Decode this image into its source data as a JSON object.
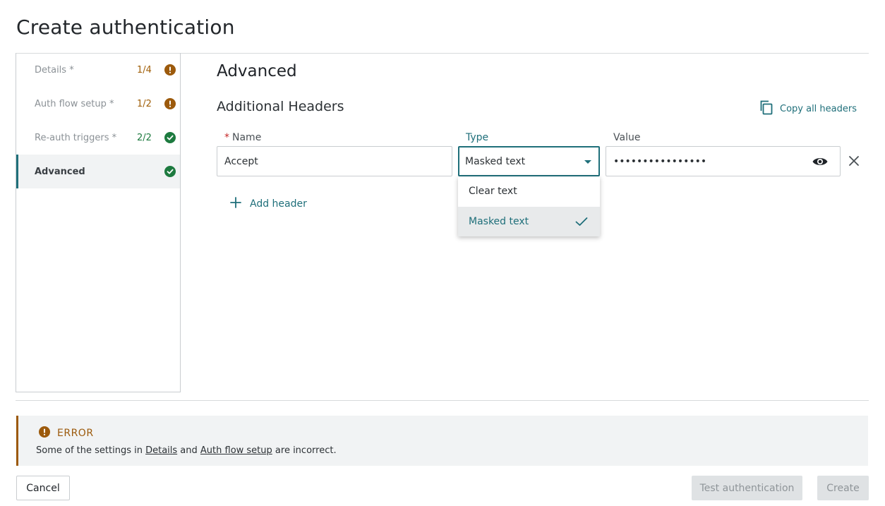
{
  "page": {
    "title": "Create authentication"
  },
  "sidebar": {
    "steps": [
      {
        "label": "Details *",
        "count": "1/4",
        "status": "warning"
      },
      {
        "label": "Auth flow setup *",
        "count": "1/2",
        "status": "warning"
      },
      {
        "label": "Re-auth triggers *",
        "count": "2/2",
        "status": "complete"
      },
      {
        "label": "Advanced",
        "count": "",
        "status": "complete",
        "active": true
      }
    ]
  },
  "main": {
    "section_title": "Advanced",
    "subsection_title": "Additional Headers",
    "copy_all_label": "Copy all headers",
    "columns": {
      "name_required_mark": "*",
      "name": "Name",
      "type": "Type",
      "value": "Value"
    },
    "header_row": {
      "name": "Accept",
      "type": "Masked text",
      "value_masked": "••••••••••••••••"
    },
    "type_dropdown": {
      "options": [
        "Clear text",
        "Masked text"
      ],
      "selected": "Masked text"
    },
    "add_header_label": "Add header"
  },
  "error": {
    "title": "ERROR",
    "message_prefix": "Some of the settings in ",
    "link1": "Details",
    "message_middle": " and ",
    "link2": "Auth flow setup",
    "message_suffix": " are incorrect."
  },
  "footer": {
    "cancel_label": "Cancel",
    "test_label": "Test authentication",
    "create_label": "Create"
  },
  "colors": {
    "accent": "#1f6f7a",
    "warning": "#9c5a0c",
    "success": "#1d7a3f",
    "required": "#c62828"
  }
}
